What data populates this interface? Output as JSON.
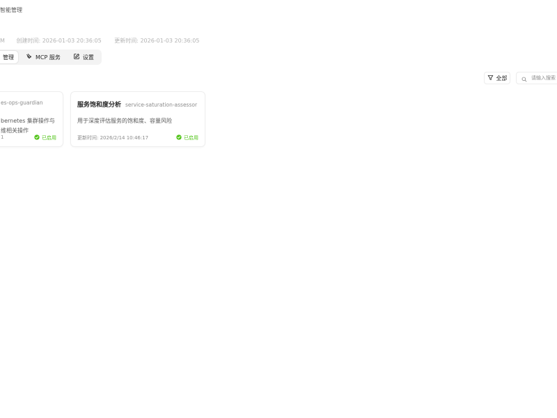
{
  "breadcrumb": "智能管理",
  "meta": {
    "first": "M",
    "created": "创建时间: 2026-01-03 20:36:05",
    "updated": "更新时间: 2026-01-03 20:36:05"
  },
  "tabs": [
    {
      "label": "管理",
      "icon": "none",
      "active": true
    },
    {
      "label": "MCP 服务",
      "icon": "mcp-icon",
      "active": false
    },
    {
      "label": "设置",
      "icon": "edit-icon",
      "active": false
    }
  ],
  "toolbar": {
    "filter_label": "全部",
    "search_placeholder": "请输入搜索"
  },
  "cards": [
    {
      "id": "es-ops-guardian",
      "title": "",
      "desc_line1": "bernetes 集群操作与",
      "desc_line2": "维相关操作",
      "updated": "1",
      "status": "已启用"
    },
    {
      "id": "service-saturation-assessor",
      "title": "服务饱和度分析",
      "desc_line1": "用于深度评估服务的饱和度、容量风险",
      "desc_line2": "",
      "updated": "更新时间: 2026/2/14 10:46:17",
      "status": "已启用"
    }
  ],
  "colors": {
    "status_green": "#52c41a",
    "muted": "#8c8c8c",
    "border": "#eeeeee"
  }
}
